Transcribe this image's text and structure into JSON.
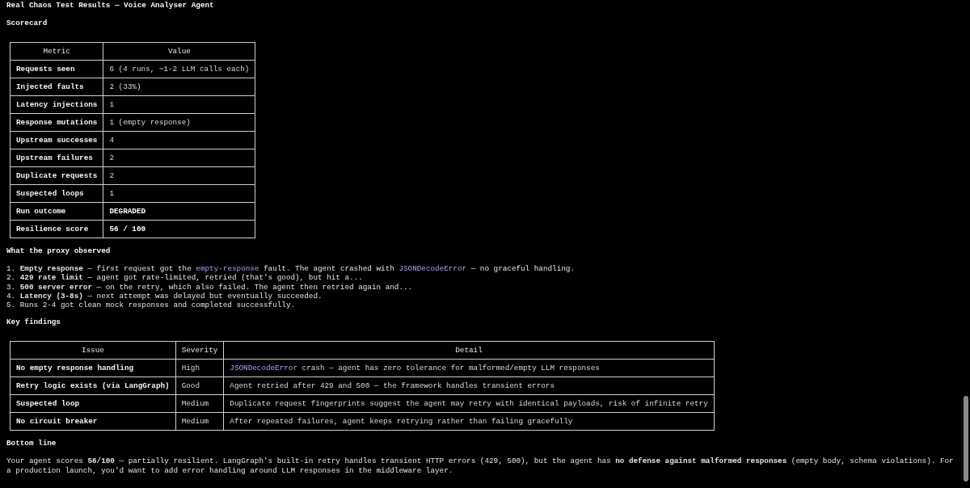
{
  "title": "Real Chaos Test Results — Voice Analyser Agent",
  "sections": [
    {
      "kind": "table",
      "heading": "Scorecard",
      "columns": [
        "Metric",
        "Value"
      ],
      "rows": [
        {
          "cells": [
            "Requests seen",
            "6 (4 runs, ~1-2 LLM calls each)"
          ],
          "emphasis": false
        },
        {
          "cells": [
            "Injected faults",
            "2 (33%)"
          ],
          "emphasis": false
        },
        {
          "cells": [
            "Latency injections",
            "1"
          ],
          "emphasis": false
        },
        {
          "cells": [
            "Response mutations",
            "1 (empty response)"
          ],
          "emphasis": false
        },
        {
          "cells": [
            "Upstream successes",
            "4"
          ],
          "emphasis": false
        },
        {
          "cells": [
            "Upstream failures",
            "2"
          ],
          "emphasis": false
        },
        {
          "cells": [
            "Duplicate requests",
            "2"
          ],
          "emphasis": false
        },
        {
          "cells": [
            "Suspected loops",
            "1"
          ],
          "emphasis": false
        },
        {
          "cells": [
            "Run outcome",
            "DEGRADED"
          ],
          "emphasis": true
        },
        {
          "cells": [
            "Resilience score",
            "56 / 100"
          ],
          "emphasis": true
        }
      ]
    },
    {
      "kind": "list",
      "heading": "What the proxy observed",
      "items": [
        [
          {
            "text": "1. ",
            "kind": "plain"
          },
          {
            "text": "Empty response",
            "kind": "bold"
          },
          {
            "text": " — first request got the ",
            "kind": "plain"
          },
          {
            "text": "empty-response",
            "kind": "code"
          },
          {
            "text": " fault. The agent crashed with ",
            "kind": "plain"
          },
          {
            "text": "JSONDecodeError",
            "kind": "code"
          },
          {
            "text": " — no graceful handling.",
            "kind": "plain"
          }
        ],
        [
          {
            "text": "2. ",
            "kind": "plain"
          },
          {
            "text": "429 rate limit",
            "kind": "bold"
          },
          {
            "text": " — agent got rate-limited, retried (that's good), but hit a...",
            "kind": "plain"
          }
        ],
        [
          {
            "text": "3. ",
            "kind": "plain"
          },
          {
            "text": "500 server error",
            "kind": "bold"
          },
          {
            "text": " — on the retry, which also failed. The agent then retried again and...",
            "kind": "plain"
          }
        ],
        [
          {
            "text": "4. ",
            "kind": "plain"
          },
          {
            "text": "Latency (3-8s)",
            "kind": "bold"
          },
          {
            "text": " — next attempt was delayed but eventually succeeded.",
            "kind": "plain"
          }
        ],
        [
          {
            "text": "5. Runs 2-4 got clean mock responses and completed successfully.",
            "kind": "plain"
          }
        ]
      ]
    },
    {
      "kind": "table",
      "heading": "Key findings",
      "columns": [
        "Issue",
        "Severity",
        "Detail"
      ],
      "rows": [
        {
          "cells": [
            "No empty response handling",
            "High",
            [
              {
                "text": "JSONDecodeError",
                "kind": "code"
              },
              {
                "text": " crash — agent has zero tolerance for malformed/empty LLM responses",
                "kind": "plain"
              }
            ]
          ],
          "emphasis": false
        },
        {
          "cells": [
            "Retry logic exists (via LangGraph)",
            "Good",
            "Agent retried after 429 and 500 — the framework handles transient errors"
          ],
          "emphasis": false
        },
        {
          "cells": [
            "Suspected loop",
            "Medium",
            "Duplicate request fingerprints suggest the agent may retry with identical payloads, risk of infinite retry"
          ],
          "emphasis": false
        },
        {
          "cells": [
            "No circuit breaker",
            "Medium",
            "After repeated failures, agent keeps retrying rather than failing gracefully"
          ],
          "emphasis": false
        }
      ]
    },
    {
      "kind": "paragraph",
      "heading": "Bottom line",
      "segments": [
        {
          "text": "Your agent scores ",
          "kind": "plain"
        },
        {
          "text": "56/100",
          "kind": "bold"
        },
        {
          "text": " — partially resilient. LangGraph's built-in retry handles transient HTTP errors (429, 500), but the agent has ",
          "kind": "plain"
        },
        {
          "text": "no defense against malformed responses",
          "kind": "bold"
        },
        {
          "text": " (empty body, schema violations). For a production launch, you'd want to add error handling around LLM responses in the middleware layer.",
          "kind": "plain"
        }
      ]
    }
  ]
}
